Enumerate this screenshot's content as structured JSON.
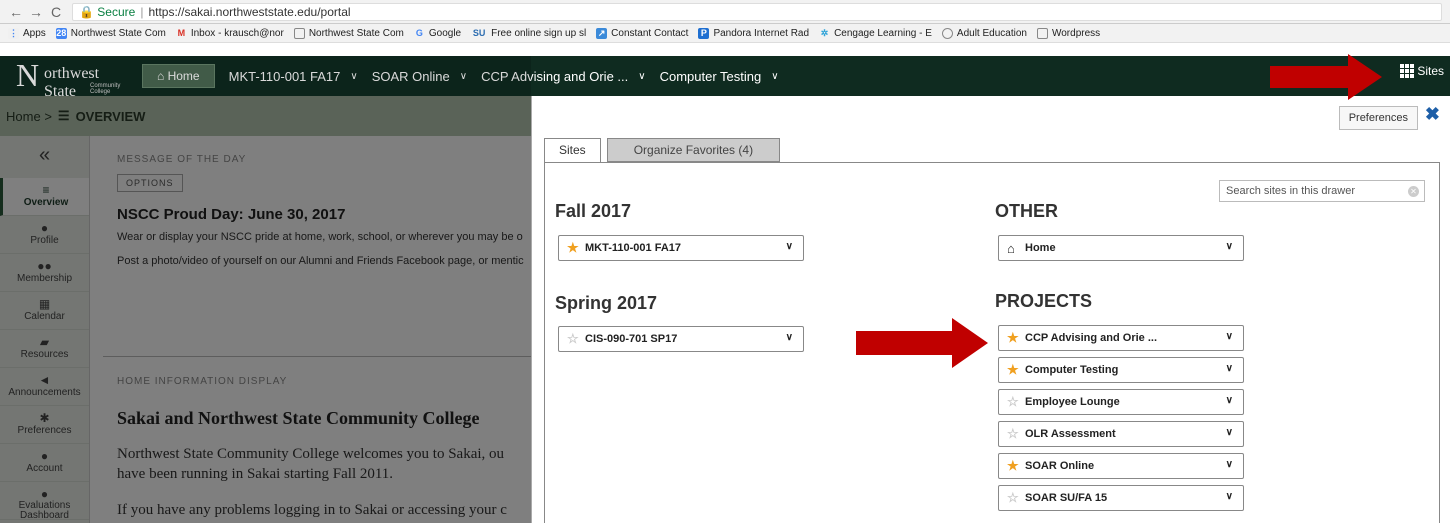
{
  "browser": {
    "back": "←",
    "forward": "→",
    "reload": "C",
    "secure_label": "Secure",
    "url": "https://sakai.northweststate.edu/portal",
    "bookmarks": [
      {
        "label": "Apps",
        "icon": "apps-icon"
      },
      {
        "label": "Northwest State Com",
        "icon": "calendar-icon"
      },
      {
        "label": "Inbox - krausch@nor",
        "icon": "gmail-icon"
      },
      {
        "label": "Northwest State Com",
        "icon": "page-icon"
      },
      {
        "label": "Google",
        "icon": "google-icon"
      },
      {
        "label": "Free online sign up sl",
        "icon": "signup-icon"
      },
      {
        "label": "Constant Contact",
        "icon": "constant-contact-icon"
      },
      {
        "label": "Pandora Internet Rad",
        "icon": "pandora-icon"
      },
      {
        "label": "Cengage Learning - E",
        "icon": "cengage-icon"
      },
      {
        "label": "Adult Education",
        "icon": "globe-icon"
      },
      {
        "label": "Wordpress",
        "icon": "page-icon"
      }
    ]
  },
  "topnav": {
    "logo_initial": "N",
    "logo_rest": "orthwest State",
    "logo_sub": "Community College",
    "home_label": "Home",
    "sites": [
      "MKT-110-001 FA17",
      "SOAR Online",
      "CCP Advising and Orie ...",
      "Computer Testing"
    ],
    "sites_button": "Sites"
  },
  "breadcrumb": {
    "home": "Home",
    "sep": ">",
    "current": "OVERVIEW"
  },
  "sidebar": {
    "collapse": "«",
    "tools": [
      {
        "label": "Overview",
        "icon": "list-icon",
        "glyph": "≡"
      },
      {
        "label": "Profile",
        "icon": "user-icon",
        "glyph": "●"
      },
      {
        "label": "Membership",
        "icon": "users-icon",
        "glyph": "●●"
      },
      {
        "label": "Calendar",
        "icon": "calendar-icon",
        "glyph": "▦"
      },
      {
        "label": "Resources",
        "icon": "folder-icon",
        "glyph": "▰"
      },
      {
        "label": "Announcements",
        "icon": "megaphone-icon",
        "glyph": "◄"
      },
      {
        "label": "Preferences",
        "icon": "gear-icon",
        "glyph": "✱"
      },
      {
        "label": "Account",
        "icon": "account-icon",
        "glyph": "●"
      },
      {
        "label": "Evaluations Dashboard",
        "icon": "comment-icon",
        "glyph": "●"
      }
    ]
  },
  "main": {
    "motd_heading": "MESSAGE OF THE DAY",
    "options_label": "OPTIONS",
    "announcement_title": "NSCC Proud Day: June 30, 2017",
    "announcement_p1": "Wear or display your NSCC pride at home, work, school, or wherever you may be o",
    "announcement_p2": "Post a photo/video of yourself on our Alumni and Friends Facebook page, or mentic",
    "info_heading": "HOME INFORMATION DISPLAY",
    "sakai_title": "Sakai and Northwest State Community College",
    "sakai_p1a": "Northwest State Community College welcomes you to Sakai, ou",
    "sakai_p1b": "have been running in Sakai starting Fall 2011.",
    "sakai_p2": "If you have any problems logging in to Sakai or accessing your c"
  },
  "drawer": {
    "preferences_label": "Preferences",
    "close_glyph": "✖",
    "tab_sites": "Sites",
    "tab_favorites": "Organize Favorites (4)",
    "search_placeholder": "Search sites in this drawer",
    "terms": {
      "fall": {
        "label": "Fall 2017",
        "sites": [
          {
            "name": "MKT-110-001 FA17",
            "fav": true
          }
        ]
      },
      "spring": {
        "label": "Spring 2017",
        "sites": [
          {
            "name": "CIS-090-701 SP17",
            "fav": false
          }
        ]
      },
      "other": {
        "label": "OTHER",
        "sites": [
          {
            "name": "Home",
            "fav": null
          }
        ]
      },
      "projects": {
        "label": "PROJECTS",
        "sites": [
          {
            "name": "CCP Advising and Orie ...",
            "fav": true
          },
          {
            "name": "Computer Testing",
            "fav": true
          },
          {
            "name": "Employee Lounge",
            "fav": false
          },
          {
            "name": "OLR Assessment",
            "fav": false
          },
          {
            "name": "SOAR Online",
            "fav": true
          },
          {
            "name": "SOAR SU/FA 15",
            "fav": false
          }
        ]
      }
    }
  },
  "colors": {
    "nav_bg": "#0f2b20",
    "breadcrumb_bg": "#b5c7b0",
    "star_on": "#f0a020",
    "arrow": "#c00000"
  }
}
